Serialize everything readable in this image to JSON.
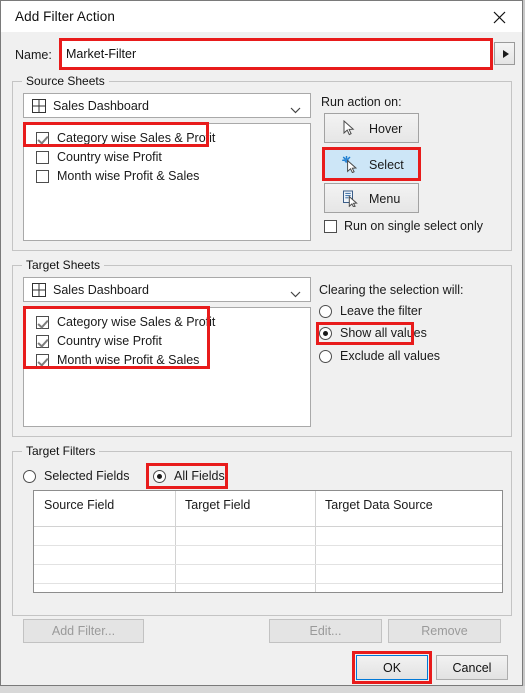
{
  "window": {
    "title": "Add Filter Action",
    "close_icon": "close-icon"
  },
  "name_field": {
    "label": "Name:",
    "value": "Market-Filter",
    "placeholder": "",
    "dropdown_icon": "triangle-right-icon"
  },
  "source_sheets": {
    "group_title": "Source Sheets",
    "dashboard_icon": "dashboard-grid-icon",
    "selected_dashboard": "Sales Dashboard",
    "chevron_icon": "chevron-down-icon",
    "sheets": [
      {
        "label": "Category wise Sales & Profit",
        "checked": true
      },
      {
        "label": "Country wise Profit",
        "checked": false
      },
      {
        "label": "Month wise Profit & Sales",
        "checked": false
      }
    ]
  },
  "run_action": {
    "label": "Run action on:",
    "options": [
      {
        "label": "Hover",
        "icon": "cursor-icon",
        "selected": false
      },
      {
        "label": "Select",
        "icon": "cursor-sparkle-icon",
        "selected": true
      },
      {
        "label": "Menu",
        "icon": "menu-cursor-icon",
        "selected": false
      }
    ],
    "single_select": {
      "label": "Run on single select only",
      "checked": false
    }
  },
  "target_sheets": {
    "group_title": "Target Sheets",
    "dashboard_icon": "dashboard-grid-icon",
    "selected_dashboard": "Sales Dashboard",
    "chevron_icon": "chevron-down-icon",
    "sheets": [
      {
        "label": "Category wise Sales & Profit",
        "checked": true
      },
      {
        "label": "Country wise Profit",
        "checked": true
      },
      {
        "label": "Month wise Profit & Sales",
        "checked": true
      }
    ]
  },
  "clearing": {
    "label": "Clearing the selection will:",
    "options": [
      {
        "label": "Leave the filter",
        "selected": false
      },
      {
        "label": "Show all values",
        "selected": true
      },
      {
        "label": "Exclude all values",
        "selected": false
      }
    ]
  },
  "target_filters": {
    "group_title": "Target Filters",
    "scope_options": [
      {
        "label": "Selected Fields",
        "selected": false
      },
      {
        "label": "All Fields",
        "selected": true
      }
    ],
    "columns": [
      "Source Field",
      "Target Field",
      "Target Data Source"
    ],
    "rows": [],
    "buttons": [
      {
        "label": "Add Filter...",
        "enabled": false
      },
      {
        "label": "Edit...",
        "enabled": false
      },
      {
        "label": "Remove",
        "enabled": false
      }
    ]
  },
  "footer": {
    "ok_label": "OK",
    "cancel_label": "Cancel"
  },
  "annotation_color": "#e81b1b",
  "accent_color": "#cde6f7"
}
